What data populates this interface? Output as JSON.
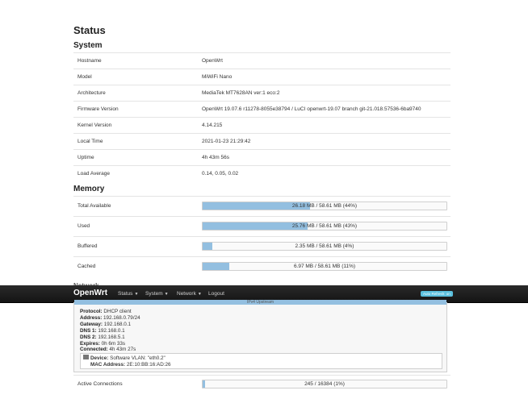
{
  "page": {
    "title": "Status"
  },
  "system": {
    "title": "System",
    "rows": [
      {
        "label": "Hostname",
        "value": "OpenWrt"
      },
      {
        "label": "Model",
        "value": "MiWiFi Nano"
      },
      {
        "label": "Architecture",
        "value": "MediaTek MT7628AN ver:1 eco:2"
      },
      {
        "label": "Firmware Version",
        "value": "OpenWrt 19.07.6 r11278-8055e38794 / LuCI openwrt-19.07 branch git-21.018.57536-6ba9740"
      },
      {
        "label": "Kernel Version",
        "value": "4.14.215"
      },
      {
        "label": "Local Time",
        "value": "2021-01-23 21:29:42"
      },
      {
        "label": "Uptime",
        "value": "4h 43m 56s"
      },
      {
        "label": "Load Average",
        "value": "0.14, 0.05, 0.02"
      }
    ]
  },
  "memory": {
    "title": "Memory",
    "rows": [
      {
        "label": "Total Available",
        "text": "26.18 MB / 58.61 MB (44%)",
        "percent": 44
      },
      {
        "label": "Used",
        "text": "25.76 MB / 58.61 MB (43%)",
        "percent": 43
      },
      {
        "label": "Buffered",
        "text": "2.35 MB / 58.61 MB (4%)",
        "percent": 4
      },
      {
        "label": "Cached",
        "text": "6.97 MB / 58.61 MB (11%)",
        "percent": 11
      }
    ]
  },
  "network": {
    "title": "Network",
    "box_title": "IPv4 Upstream",
    "lines": [
      {
        "key": "Protocol:",
        "value": "DHCP client"
      },
      {
        "key": "Address:",
        "value": "192.168.0.79/24"
      },
      {
        "key": "Gateway:",
        "value": "192.168.0.1"
      },
      {
        "key": "DNS 1:",
        "value": "192.168.0.1"
      },
      {
        "key": "DNS 2:",
        "value": "192.168.5.1"
      },
      {
        "key": "Expires:",
        "value": "0h 6m 33s"
      },
      {
        "key": "Connected:",
        "value": "4h 43m 27s"
      }
    ],
    "device": {
      "key": "Device:",
      "value": "Software VLAN: \"eth0.2\"",
      "mac_key": "MAC Address:",
      "mac_value": "2E:10:BB:16:AD:26"
    },
    "active_connections": {
      "label": "Active Connections",
      "text": "245 / 16384 (1%)",
      "percent": 1
    }
  },
  "navbar": {
    "brand": "OpenWrt",
    "items": [
      "Status",
      "System",
      "Network",
      "Logout"
    ],
    "auto_refresh": "Auto Refresh: on"
  },
  "colors": {
    "bar_fill": "#93bfe0",
    "navbar": "#1e1e1e",
    "auto_refresh": "#5bc0de"
  }
}
